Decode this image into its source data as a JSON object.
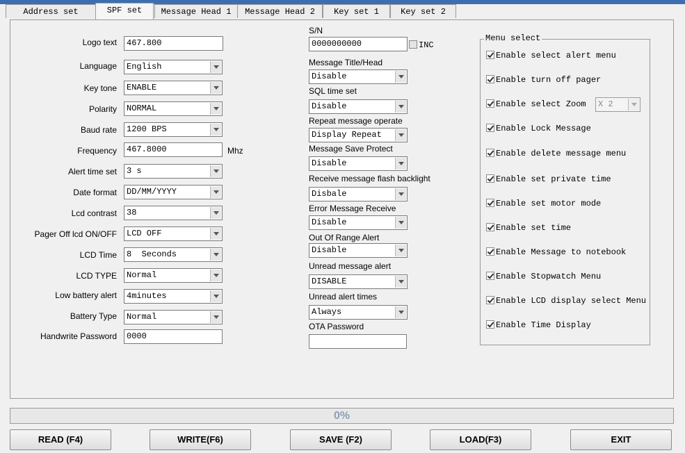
{
  "tabs": [
    "Address set",
    "SPF set",
    "Message Head 1",
    "Message Head 2",
    "Key set 1",
    "Key set 2"
  ],
  "active_tab": "SPF set",
  "left": {
    "logo_text": {
      "label": "Logo text",
      "value": "467.800"
    },
    "language": {
      "label": "Language",
      "value": "English"
    },
    "key_tone": {
      "label": "Key tone",
      "value": "ENABLE"
    },
    "polarity": {
      "label": "Polarity",
      "value": "NORMAL"
    },
    "baud_rate": {
      "label": "Baud rate",
      "value": "1200 BPS"
    },
    "frequency": {
      "label": "Frequency",
      "value": "467.8000",
      "unit": "Mhz"
    },
    "alert_time": {
      "label": "Alert time set",
      "value": "3 s"
    },
    "date_format": {
      "label": "Date format",
      "value": "DD/MM/YYYY"
    },
    "lcd_contrast": {
      "label": "Lcd contrast",
      "value": "38"
    },
    "pager_off_lcd": {
      "label": "Pager Off lcd ON/OFF",
      "value": "LCD OFF"
    },
    "lcd_time": {
      "label": "LCD Time",
      "value": "8  Seconds"
    },
    "lcd_type": {
      "label": "LCD TYPE",
      "value": "Normal"
    },
    "low_battery": {
      "label": "Low battery alert",
      "value": "4minutes"
    },
    "battery_type": {
      "label": "Battery Type",
      "value": "Normal"
    },
    "handwrite_password": {
      "label": "Handwrite Password",
      "value": "0000"
    }
  },
  "middle": {
    "sn": {
      "label": "S/N",
      "value": "0000000000",
      "inc_label": "INC"
    },
    "msg_title": {
      "label": "Message Title/Head",
      "value": "Disable"
    },
    "sql_time": {
      "label": "SQL time  set",
      "value": "Disable"
    },
    "repeat_msg": {
      "label": "Repeat message operate",
      "value": "Display Repeat"
    },
    "save_protect": {
      "label": "Message Save Protect",
      "value": "Disable"
    },
    "flash_backlight": {
      "label": "Receive message flash backlight",
      "value": "Disbale"
    },
    "error_msg": {
      "label": "Error Message Receive",
      "value": "Disable"
    },
    "out_of_range": {
      "label": "Out Of Range Alert",
      "value": "Disable"
    },
    "unread_alert": {
      "label": "Unread message alert",
      "value": "DISABLE"
    },
    "unread_times": {
      "label": "Unread alert times",
      "value": "Always"
    },
    "ota_password": {
      "label": "OTA Password",
      "value": ""
    }
  },
  "menu_select": {
    "title": "Menu select",
    "zoom_value": "X 2",
    "items": [
      "Enable select alert menu",
      "Enable turn off pager",
      "Enable select Zoom",
      "Enable Lock Message",
      "Enable delete message menu",
      "Enable set private time",
      "Enable set motor mode",
      "Enable set time",
      "Enable Message to notebook",
      "Enable Stopwatch Menu",
      "Enable LCD display select Menu",
      "Enable Time Display"
    ]
  },
  "progress": {
    "text": "0%",
    "value": 0
  },
  "buttons": {
    "read": "READ (F4)",
    "write": "WRITE(F6)",
    "save": "SAVE  (F2)",
    "load": "LOAD(F3)",
    "exit": "EXIT"
  }
}
